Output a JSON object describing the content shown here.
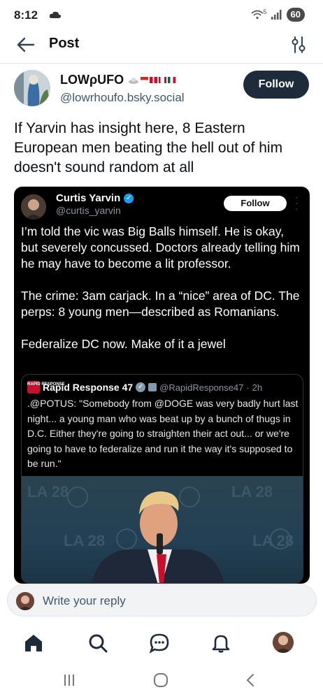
{
  "status_bar": {
    "time": "8:12",
    "battery": "60",
    "network": "5"
  },
  "header": {
    "title": "Post",
    "back_icon": "arrow-left-icon",
    "filter_icon": "sliders-icon"
  },
  "post": {
    "author_name": "LOWρUFO",
    "author_handle": "@lowrhoufo.bsky.social",
    "follow_label": "Follow",
    "text": "If Yarvin has insight here, 8 Eastern European men beating the hell out of him doesn't sound random at all"
  },
  "embedded_tweet": {
    "author_name": "Curtis Yarvin",
    "author_handle": "@curtis_yarvin",
    "follow_label": "Follow",
    "paragraphs": [
      "I’m told the vic was Big Balls himself. He is okay, but severely concussed. Doctors already telling him he may have to become a lit professor.",
      "The crime: 3am carjack. In a “nice” area of DC. The perps: 8 young men—described as Romanians.",
      "Federalize DC now. Make of it a jewel"
    ],
    "quote": {
      "author_name": "Rapid Response 47",
      "author_handle": "@RapidResponse47",
      "separator": "·",
      "time": "2h",
      "text": ".@POTUS: \"Somebody from @DOGE was very badly hurt last night... a young man who was beat up by a bunch of thugs in D.C. Either they're going to straighten their act out... or we're going to have to federalize and run it the way it's supposed to be run.\"",
      "logo_text": "RAPID RESPONSE",
      "backdrop_text": "LA 28"
    }
  },
  "reply": {
    "placeholder": "Write your reply"
  },
  "nav": {
    "items": [
      "home-icon",
      "search-icon",
      "chat-icon",
      "bell-icon",
      "profile-avatar"
    ]
  },
  "colors": {
    "follow_button": "#1e2b3a",
    "handle": "#42576c",
    "embed_bg": "#000000"
  }
}
